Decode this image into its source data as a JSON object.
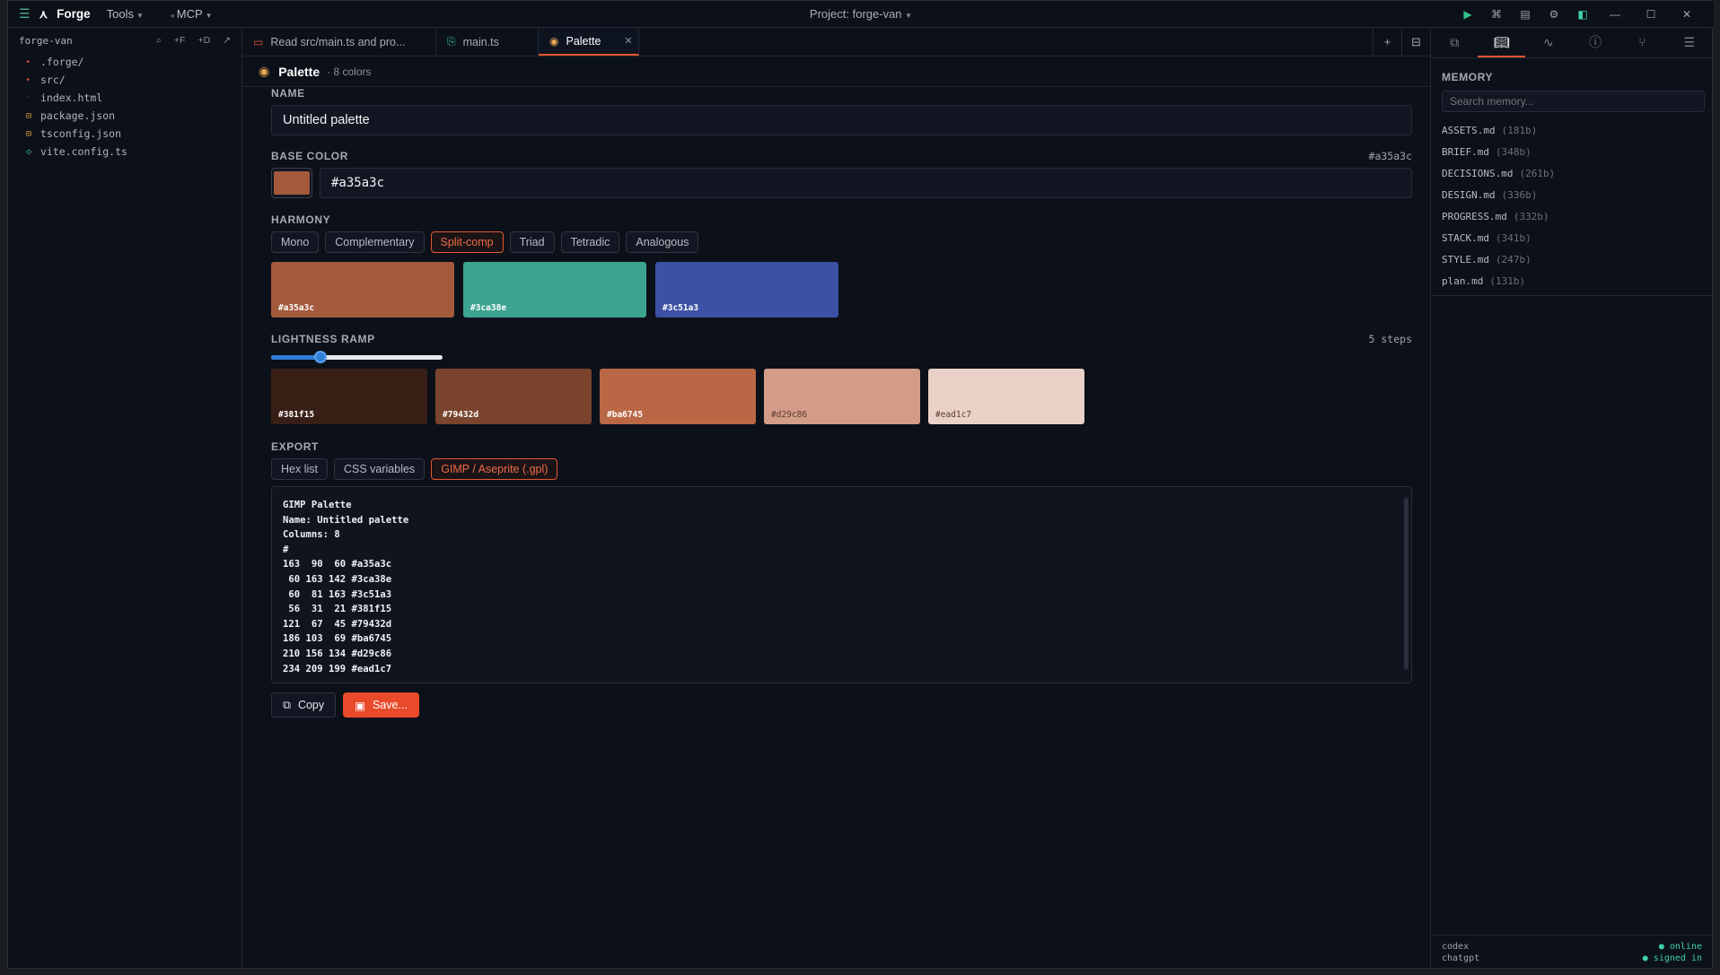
{
  "titlebar": {
    "brand": "Forge",
    "menus": [
      "Tools",
      "MCP"
    ],
    "project": "Project: forge-van",
    "colors": {
      "play": "#33c28a",
      "accent": "#e6572f"
    }
  },
  "explorer": {
    "project_name": "forge-van",
    "actions": [
      "+F",
      "+D"
    ],
    "items": [
      {
        "name": ".forge/",
        "kind": "folder"
      },
      {
        "name": "src/",
        "kind": "folder"
      },
      {
        "name": "index.html",
        "kind": "file"
      },
      {
        "name": "package.json",
        "kind": "json"
      },
      {
        "name": "tsconfig.json",
        "kind": "json"
      },
      {
        "name": "vite.config.ts",
        "kind": "ts"
      }
    ]
  },
  "tabs": [
    {
      "label": "Read src/main.ts and pro...",
      "icon": "chat-icon"
    },
    {
      "label": "main.ts",
      "icon": "file-code-icon"
    },
    {
      "label": "Palette",
      "icon": "palette-icon",
      "active": true
    }
  ],
  "palette": {
    "title": "Palette",
    "count": "· 8 colors",
    "name_label": "NAME",
    "name_value": "Untitled palette",
    "base_label": "BASE COLOR",
    "base_hex_display": "#a35a3c",
    "base_value": "#a35a3c",
    "harmony_label": "HARMONY",
    "harmony_options": [
      "Mono",
      "Complementary",
      "Split-comp",
      "Triad",
      "Tetradic",
      "Analogous"
    ],
    "harmony_selected": "Split-comp",
    "harmony_swatches": [
      "#a35a3c",
      "#3ca38e",
      "#3c51a3"
    ],
    "ramp_label": "LIGHTNESS RAMP",
    "ramp_steps_label": "5 steps",
    "ramp_slider_fraction": 0.27,
    "ramp_swatches": [
      "#381f15",
      "#79432d",
      "#ba6745",
      "#d29c86",
      "#ead1c7"
    ],
    "export_label": "EXPORT",
    "export_options": [
      "Hex list",
      "CSS variables",
      "GIMP / Aseprite (.gpl)"
    ],
    "export_selected": "GIMP / Aseprite (.gpl)",
    "export_text": "GIMP Palette\nName: Untitled palette\nColumns: 8\n#\n163  90  60 #a35a3c\n 60 163 142 #3ca38e\n 60  81 163 #3c51a3\n 56  31  21 #381f15\n121  67  45 #79432d\n186 103  69 #ba6745\n210 156 134 #d29c86\n234 209 199 #ead1c7",
    "copy_label": "Copy",
    "save_label": "Save..."
  },
  "memory": {
    "title": "MEMORY",
    "search_placeholder": "Search memory...",
    "items": [
      {
        "name": "ASSETS.md",
        "size": "(181b)"
      },
      {
        "name": "BRIEF.md",
        "size": "(348b)"
      },
      {
        "name": "DECISIONS.md",
        "size": "(261b)"
      },
      {
        "name": "DESIGN.md",
        "size": "(336b)"
      },
      {
        "name": "PROGRESS.md",
        "size": "(332b)"
      },
      {
        "name": "STACK.md",
        "size": "(341b)"
      },
      {
        "name": "STYLE.md",
        "size": "(247b)"
      },
      {
        "name": "plan.md",
        "size": "(131b)"
      }
    ]
  },
  "status": [
    {
      "name": "codex",
      "state": "● online"
    },
    {
      "name": "chatgpt",
      "state": "● signed in"
    }
  ]
}
